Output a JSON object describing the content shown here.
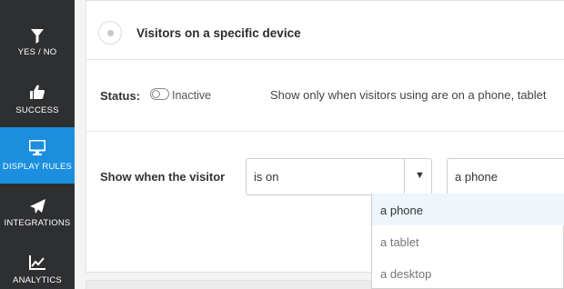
{
  "sidebar": {
    "items": [
      {
        "label": "YES / NO",
        "icon": "filter-icon"
      },
      {
        "label": "SUCCESS",
        "icon": "thumbs-up-icon"
      },
      {
        "label": "DISPLAY RULES",
        "icon": "monitor-icon",
        "active": true
      },
      {
        "label": "INTEGRATIONS",
        "icon": "paper-plane-icon"
      },
      {
        "label": "ANALYTICS",
        "icon": "line-chart-icon"
      }
    ]
  },
  "rule": {
    "title": "Visitors on a specific device",
    "status_label": "Status:",
    "status_value": "Inactive",
    "description": "Show only when visitors using are on a phone, tablet",
    "show_label": "Show when the visitor",
    "condition": {
      "selected": "is on",
      "caret": "▼"
    },
    "device": {
      "selected": "a phone",
      "options": [
        "a phone",
        "a tablet",
        "a desktop"
      ],
      "highlighted_index": 0
    }
  },
  "colors": {
    "sidebar_bg": "#2e2f31",
    "active_bg": "#1b8fde",
    "option_highlight": "#eef6fc"
  }
}
